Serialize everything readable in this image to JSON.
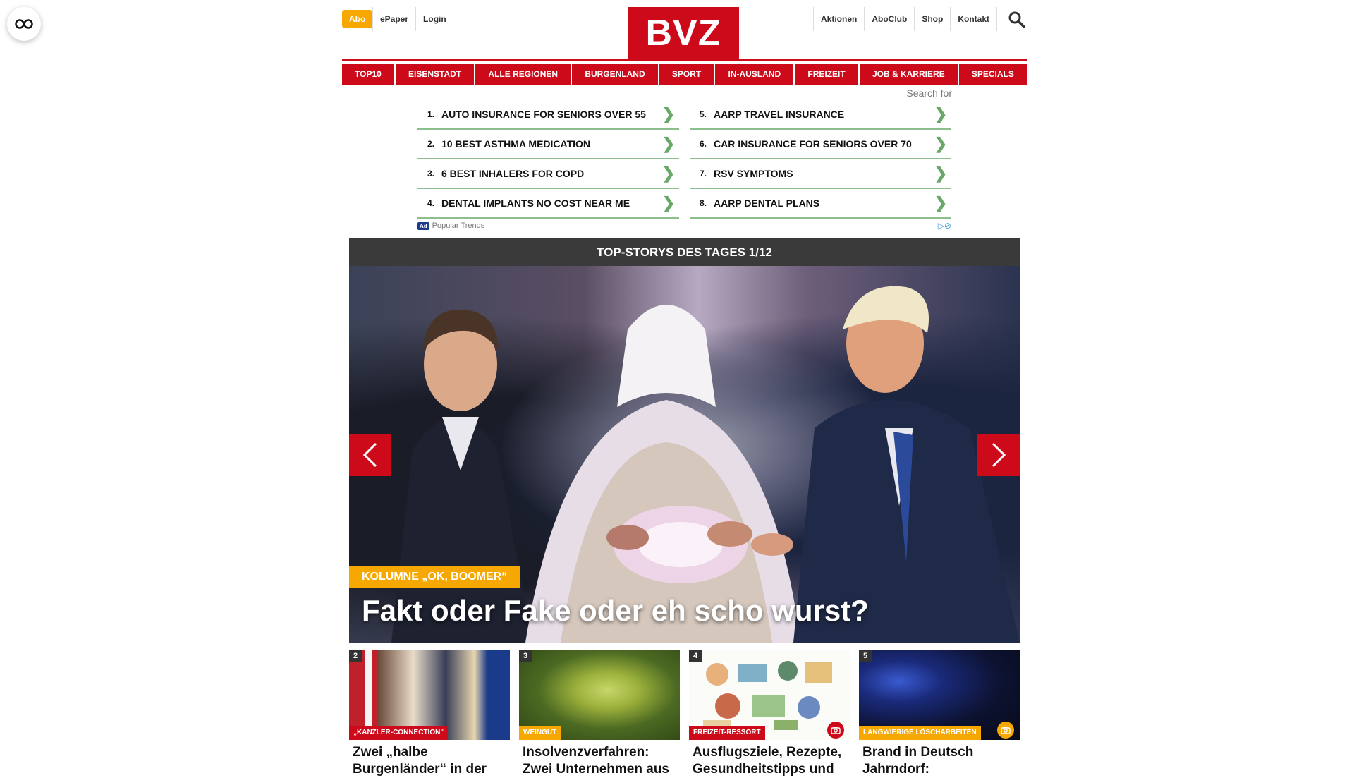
{
  "header": {
    "abo_label": "Abo",
    "left_links": [
      "ePaper",
      "Login"
    ],
    "right_links": [
      "Aktionen",
      "AboClub",
      "Shop",
      "Kontakt"
    ],
    "logo_text": "BVZ",
    "brand_color": "#cc0a1a",
    "accent_color": "#f7a800"
  },
  "nav": {
    "items": [
      "TOP10",
      "EISENSTADT",
      "ALLE REGIONEN",
      "BURGENLAND",
      "SPORT",
      "IN-AUSLAND",
      "FREIZEIT",
      "JOB & KARRIERE",
      "SPECIALS"
    ]
  },
  "ad": {
    "search_label": "Search for",
    "items": [
      {
        "num": "1.",
        "text": "AUTO INSURANCE FOR SENIORS OVER 55"
      },
      {
        "num": "5.",
        "text": "AARP TRAVEL INSURANCE"
      },
      {
        "num": "2.",
        "text": "10 BEST ASTHMA MEDICATION"
      },
      {
        "num": "6.",
        "text": "CAR INSURANCE FOR SENIORS OVER 70"
      },
      {
        "num": "3.",
        "text": "6 BEST INHALERS FOR COPD"
      },
      {
        "num": "7.",
        "text": "RSV SYMPTOMS"
      },
      {
        "num": "4.",
        "text": "DENTAL IMPLANTS NO COST NEAR ME"
      },
      {
        "num": "8.",
        "text": "AARP DENTAL PLANS"
      }
    ],
    "badge": "Ad",
    "footer_label": "Popular Trends"
  },
  "hero": {
    "header": "TOP-STORYS DES TAGES 1/12",
    "kicker": "KOLUMNE „OK, BOOMER“",
    "title": "Fakt oder Fake oder eh scho wurst?"
  },
  "teasers": [
    {
      "num": "2",
      "kicker": "„KANZLER-CONNECTION“",
      "kicker_style": "red",
      "title": "Zwei „halbe Burgenländer“ in der",
      "has_camera": false
    },
    {
      "num": "3",
      "kicker": "WEINGUT",
      "kicker_style": "orange",
      "title": "Insolvenzverfahren: Zwei Unternehmen aus",
      "has_camera": false
    },
    {
      "num": "4",
      "kicker": "FREIZEIT-RESSORT",
      "kicker_style": "red",
      "title": "Ausflugsziele, Rezepte, Gesundheitstipps und",
      "has_camera": true
    },
    {
      "num": "5",
      "kicker": "LANGWIERIGE LÖSCHARBEITEN",
      "kicker_style": "orange",
      "title": "Brand in Deutsch Jahrndorf:",
      "has_camera": true
    }
  ]
}
